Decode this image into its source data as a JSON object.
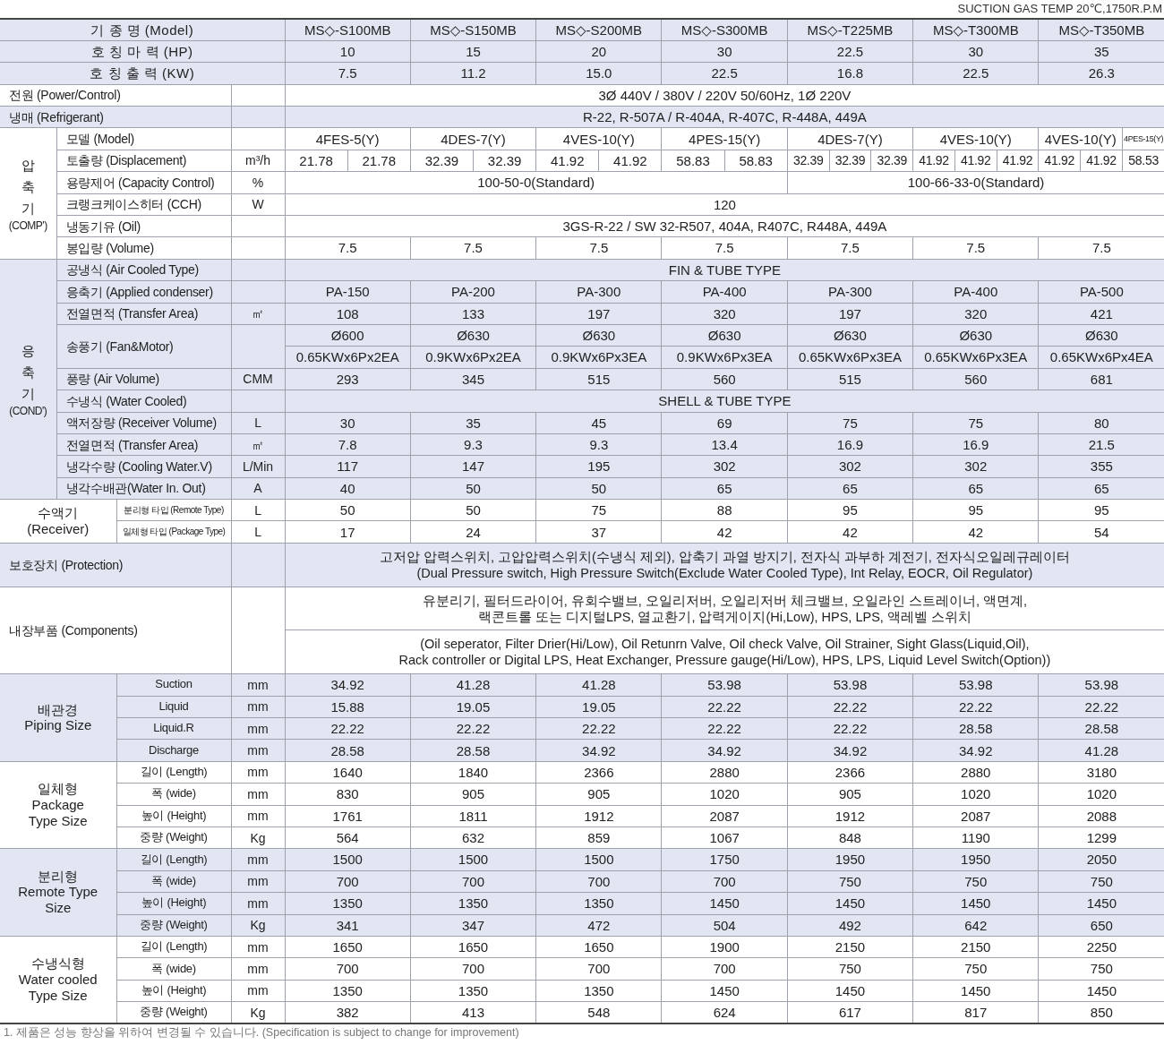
{
  "caption": "SUCTION GAS TEMP 20℃,1750R.P.M",
  "headers": [
    {
      "label": "기 종 명 (Model)",
      "values": [
        "MS◇-S100MB",
        "MS◇-S150MB",
        "MS◇-S200MB",
        "MS◇-S300MB",
        "MS◇-T225MB",
        "MS◇-T300MB",
        "MS◇-T350MB"
      ]
    },
    {
      "label": "호 칭 마 력 (HP)",
      "values": [
        "10",
        "15",
        "20",
        "30",
        "22.5",
        "30",
        "35"
      ]
    },
    {
      "label": "호 칭 출 력 (KW)",
      "values": [
        "7.5",
        "11.2",
        "15.0",
        "22.5",
        "16.8",
        "22.5",
        "26.3"
      ]
    }
  ],
  "sections": [
    {
      "kind": "plain",
      "rows": [
        {
          "label": "전원 (Power/Control)",
          "values": [
            "3Ø 440V / 380V / 220V 50/60Hz, 1Ø 220V"
          ]
        }
      ]
    },
    {
      "kind": "plain",
      "rows": [
        {
          "label": "냉매 (Refrigerant)",
          "values": [
            "R-22, R-507A / R-404A, R-407C, R-448A, 449A"
          ]
        }
      ]
    },
    {
      "kind": "group",
      "title": "압축기",
      "subtitle": "(COMP')",
      "compressors": [
        [
          {
            "model": "4FES-5(Y)",
            "displacement": [
              "21.78",
              "21.78"
            ]
          }
        ],
        [
          {
            "model": "4DES-7(Y)",
            "displacement": [
              "32.39",
              "32.39"
            ]
          }
        ],
        [
          {
            "model": "4VES-10(Y)",
            "displacement": [
              "41.92",
              "41.92"
            ]
          }
        ],
        [
          {
            "model": "4PES-15(Y)",
            "displacement": [
              "58.83",
              "58.83"
            ]
          }
        ],
        [
          {
            "model": "4DES-7(Y)",
            "displacement": [
              "32.39",
              "32.39",
              "32.39"
            ]
          }
        ],
        [
          {
            "model": "4VES-10(Y)",
            "displacement": [
              "41.92",
              "41.92",
              "41.92"
            ]
          }
        ],
        [
          {
            "model": "4VES-10(Y)",
            "displacement": [
              "41.92",
              "41.92"
            ]
          },
          {
            "model": "4PES-15(Y)",
            "displacement": [
              "58.53"
            ]
          }
        ]
      ],
      "rows": [
        {
          "kind": "models",
          "label": "모델 (Model)"
        },
        {
          "kind": "displacement",
          "label": "토출량 (Displacement)",
          "unit": "m³/h"
        },
        {
          "label": "용량제어 (Capacity Control)",
          "unit": "%",
          "values": [
            "100-50-0(Standard)",
            "100-66-33-0(Standard)"
          ]
        },
        {
          "label": "크랭크케이스히터 (CCH)",
          "unit": "W",
          "values": [
            "120"
          ]
        },
        {
          "label": "냉동기유 (Oil)",
          "values": [
            "3GS-R-22 / SW 32-R507, 404A, R407C, R448A, 449A"
          ]
        },
        {
          "label": "봉입량 (Volume)",
          "values": [
            "7.5",
            "7.5",
            "7.5",
            "7.5",
            "7.5",
            "7.5",
            "7.5"
          ]
        }
      ]
    },
    {
      "kind": "group",
      "title": "응축기",
      "subtitle": "(COND')",
      "rows": [
        {
          "label": "공냉식 (Air Cooled Type)",
          "values": [
            "FIN & TUBE TYPE"
          ]
        },
        {
          "label": "응축기 (Applied condenser)",
          "values": [
            "PA-150",
            "PA-200",
            "PA-300",
            "PA-400",
            "PA-300",
            "PA-400",
            "PA-500"
          ]
        },
        {
          "label": "전열면적 (Transfer Area)",
          "unit": "㎡",
          "values": [
            "108",
            "133",
            "197",
            "320",
            "197",
            "320",
            "421"
          ]
        },
        {
          "label": "송풍기 (Fan&Motor)",
          "value_rows": [
            [
              "Ø600",
              "Ø630",
              "Ø630",
              "Ø630",
              "Ø630",
              "Ø630",
              "Ø630"
            ],
            [
              "0.65KWx6Px2EA",
              "0.9KWx6Px2EA",
              "0.9KWx6Px3EA",
              "0.9KWx6Px3EA",
              "0.65KWx6Px3EA",
              "0.65KWx6Px3EA",
              "0.65KWx6Px4EA"
            ]
          ]
        },
        {
          "label": "풍량 (Air Volume)",
          "unit": "CMM",
          "values": [
            "293",
            "345",
            "515",
            "560",
            "515",
            "560",
            "681"
          ]
        },
        {
          "label": "수냉식 (Water Cooled)",
          "values": [
            "SHELL & TUBE TYPE"
          ]
        },
        {
          "label": "액저장량 (Receiver Volume)",
          "unit": "L",
          "values": [
            "30",
            "35",
            "45",
            "69",
            "75",
            "75",
            "80"
          ]
        },
        {
          "label": "전열면적 (Transfer Area)",
          "unit": "㎡",
          "values": [
            "7.8",
            "9.3",
            "9.3",
            "13.4",
            "16.9",
            "16.9",
            "21.5"
          ]
        },
        {
          "label": "냉각수량 (Cooling Water.V)",
          "unit": "L/Min",
          "values": [
            "117",
            "147",
            "195",
            "302",
            "302",
            "302",
            "355"
          ]
        },
        {
          "label": "냉각수배관(Water In. Out)",
          "unit": "A",
          "values": [
            "40",
            "50",
            "50",
            "65",
            "65",
            "65",
            "65"
          ]
        }
      ]
    },
    {
      "kind": "wide_group",
      "title": "수액기",
      "subtitle": "(Receiver)",
      "rows": [
        {
          "label": "분리형 타입 (Remote Type)",
          "unit": "L",
          "values": [
            "50",
            "50",
            "75",
            "88",
            "95",
            "95",
            "95"
          ]
        },
        {
          "label": "일체형 타입 (Package Type)",
          "unit": "L",
          "values": [
            "17",
            "24",
            "37",
            "42",
            "42",
            "42",
            "54"
          ]
        }
      ]
    },
    {
      "kind": "plain",
      "rows": [
        {
          "label": "보호장치 (Protection)",
          "paragraphs": [
            [
              "고저압 압력스위치, 고압압력스위치(수냉식 제외), 압축기 과열 방지기, 전자식 과부하 계전기, 전자식오일레규레이터",
              "(Dual Pressure switch, High Pressure Switch(Exclude Water Cooled Type), Int Relay, EOCR, Oil Regulator)"
            ]
          ]
        }
      ]
    },
    {
      "kind": "plain",
      "rows": [
        {
          "label": "내장부품 (Components)",
          "paragraphs": [
            [
              "유분리기, 필터드라이어, 유회수밸브, 오일리저버, 오일리저버 체크밸브, 오일라인 스트레이너, 액면계,",
              "랙콘트롤 또는 디지털LPS, 열교환기, 압력게이지(Hi,Low), HPS, LPS, 액레벨 스위치"
            ],
            [
              "(Oil seperator, Filter Drier(Hi/Low), Oil Retunrn Valve, Oil check Valve, Oil Strainer, Sight Glass(Liquid,Oil),",
              "Rack controller or Digital LPS, Heat Exchanger, Pressure gauge(Hi/Low), HPS, LPS, Liquid Level Switch(Option))"
            ]
          ]
        }
      ]
    },
    {
      "kind": "wide_group",
      "title": "배관경",
      "subtitle": "Piping Size",
      "rows": [
        {
          "label": "Suction",
          "unit": "mm",
          "values": [
            "34.92",
            "41.28",
            "41.28",
            "53.98",
            "53.98",
            "53.98",
            "53.98"
          ]
        },
        {
          "label": "Liquid",
          "unit": "mm",
          "values": [
            "15.88",
            "19.05",
            "19.05",
            "22.22",
            "22.22",
            "22.22",
            "22.22"
          ]
        },
        {
          "label": "Liquid.R",
          "unit": "mm",
          "values": [
            "22.22",
            "22.22",
            "22.22",
            "22.22",
            "22.22",
            "28.58",
            "28.58"
          ]
        },
        {
          "label": "Discharge",
          "unit": "mm",
          "values": [
            "28.58",
            "28.58",
            "34.92",
            "34.92",
            "34.92",
            "34.92",
            "41.28"
          ]
        }
      ]
    },
    {
      "kind": "wide_group",
      "title": "일체형",
      "subtitle": "Package Type Size",
      "rows": [
        {
          "label": "길이 (Length)",
          "unit": "mm",
          "values": [
            "1640",
            "1840",
            "2366",
            "2880",
            "2366",
            "2880",
            "3180"
          ]
        },
        {
          "label": "폭 (wide)",
          "unit": "mm",
          "values": [
            "830",
            "905",
            "905",
            "1020",
            "905",
            "1020",
            "1020"
          ]
        },
        {
          "label": "높이 (Height)",
          "unit": "mm",
          "values": [
            "1761",
            "1811",
            "1912",
            "2087",
            "1912",
            "2087",
            "2088"
          ]
        },
        {
          "label": "중량 (Weight)",
          "unit": "Kg",
          "values": [
            "564",
            "632",
            "859",
            "1067",
            "848",
            "1190",
            "1299"
          ]
        }
      ]
    },
    {
      "kind": "wide_group",
      "title": "분리형",
      "subtitle": "Remote Type Size",
      "rows": [
        {
          "label": "길이 (Length)",
          "unit": "mm",
          "values": [
            "1500",
            "1500",
            "1500",
            "1750",
            "1950",
            "1950",
            "2050"
          ]
        },
        {
          "label": "폭 (wide)",
          "unit": "mm",
          "values": [
            "700",
            "700",
            "700",
            "700",
            "750",
            "750",
            "750"
          ]
        },
        {
          "label": "높이 (Height)",
          "unit": "mm",
          "values": [
            "1350",
            "1350",
            "1350",
            "1450",
            "1450",
            "1450",
            "1450"
          ]
        },
        {
          "label": "중량 (Weight)",
          "unit": "Kg",
          "values": [
            "341",
            "347",
            "472",
            "504",
            "492",
            "642",
            "650"
          ]
        }
      ]
    },
    {
      "kind": "wide_group",
      "title": "수냉식형",
      "subtitle": "Water cooled Type Size",
      "rows": [
        {
          "label": "길이 (Length)",
          "unit": "mm",
          "values": [
            "1650",
            "1650",
            "1650",
            "1900",
            "2150",
            "2150",
            "2250"
          ]
        },
        {
          "label": "폭 (wide)",
          "unit": "mm",
          "values": [
            "700",
            "700",
            "700",
            "700",
            "750",
            "750",
            "750"
          ]
        },
        {
          "label": "높이 (Height)",
          "unit": "mm",
          "values": [
            "1350",
            "1350",
            "1350",
            "1450",
            "1450",
            "1450",
            "1450"
          ]
        },
        {
          "label": "중량 (Weight)",
          "unit": "Kg",
          "values": [
            "382",
            "413",
            "548",
            "624",
            "617",
            "817",
            "850"
          ]
        }
      ]
    }
  ],
  "footnote": "1. 제품은 성능 향상을 위하여 변경될 수 있습니다. (Specification is subject to change for improvement)"
}
